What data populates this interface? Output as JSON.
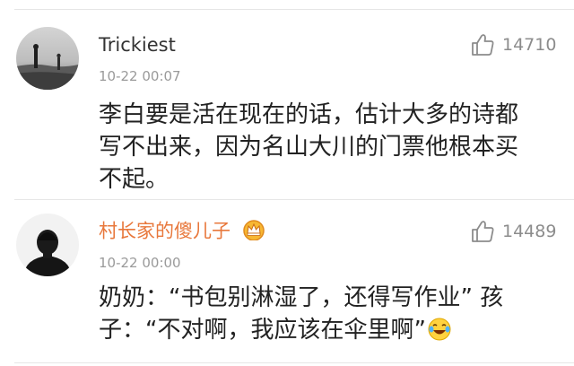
{
  "comments": [
    {
      "username": "Trickiest",
      "time": "10-22 00:07",
      "text": "李白要是活在现在的话，估计大多的诗都写不出来，因为名山大川的门票他根本买不起。",
      "likes": "14710",
      "username_color": "#333333"
    },
    {
      "username": "村长家的傻儿子",
      "time": "10-22 00:00",
      "text": "奶奶：“书包别淋湿了，还得写作业” 孩子：“不对啊，我应该在伞里啊”",
      "likes": "14489",
      "username_color": "#e8783c",
      "badge_icon": "crown-vip-icon",
      "trailing_emoji": "laughing-tears-emoji"
    }
  ]
}
